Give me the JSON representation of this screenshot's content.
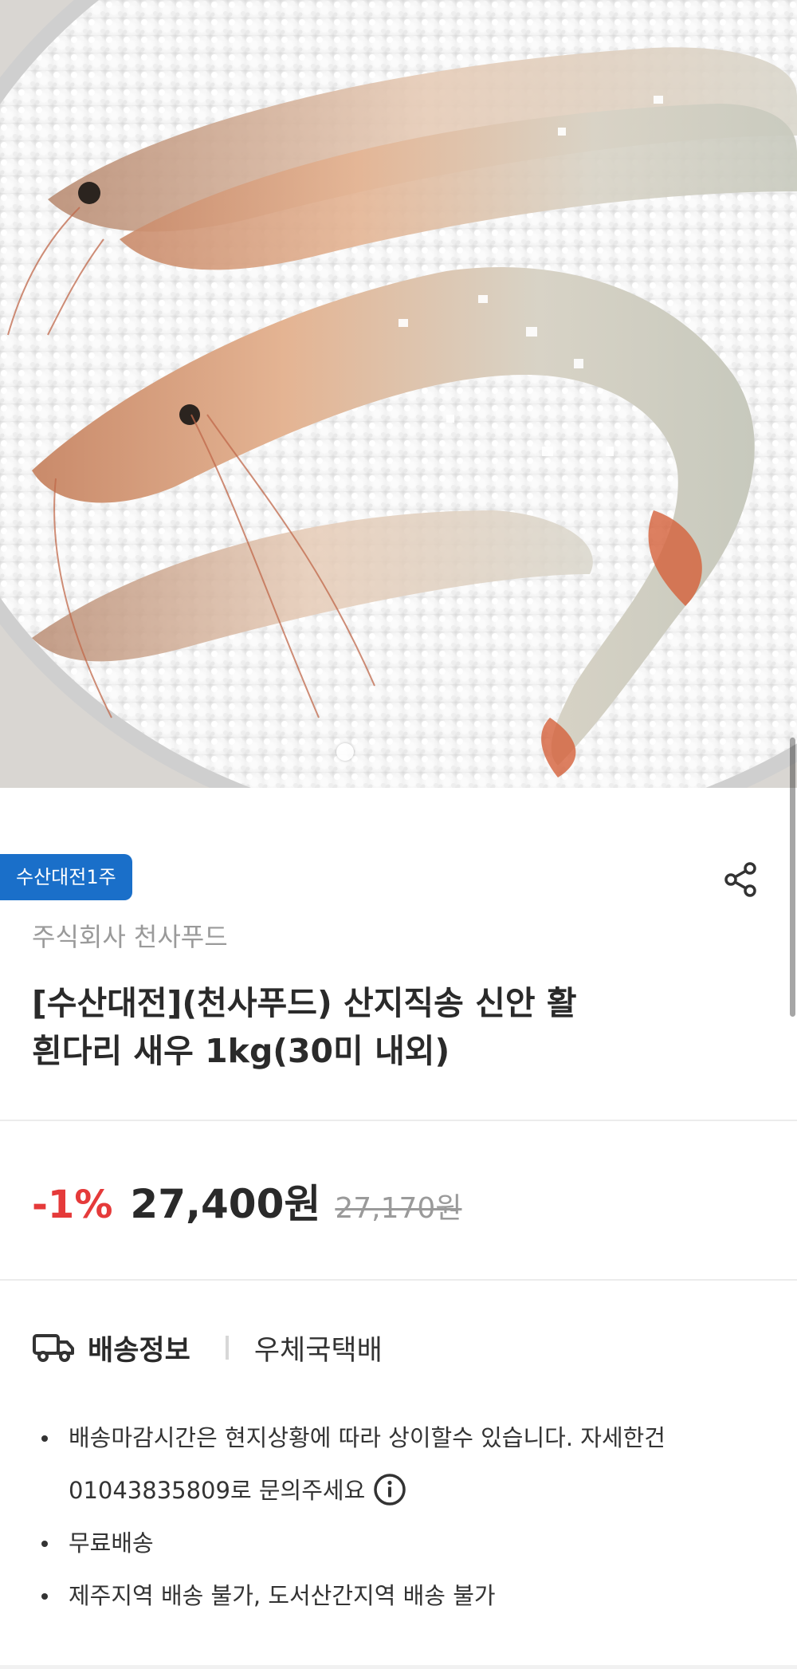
{
  "hero": {
    "alt": "salt-baked shrimp on coarse salt",
    "carousel_active_index": 0
  },
  "product": {
    "badge": "수산대전1주",
    "seller": "주식회사 천사푸드",
    "title_line1": "[수산대전](천사푸드) 산지직송 신안 활",
    "title_line2": "흰다리 새우 1kg(30미 내외)"
  },
  "price": {
    "discount": "-1%",
    "sale": "27,400원",
    "original": "27,170원"
  },
  "delivery": {
    "label": "배송정보",
    "carrier": "우체국택배",
    "notes": [
      "배송마감시간은 현지상황에 따라 상이할수 있습니다. 자세한건",
      "01043835809로 문의주세요",
      "무료배송",
      "제주지역 배송 불가, 도서산간지역 배송 불가"
    ]
  },
  "colors": {
    "badge_bg": "#1a6fc9",
    "discount": "#e53a3a",
    "text": "#2a2a2a",
    "muted": "#9a9a9a"
  },
  "icons": [
    "share-icon",
    "truck-icon",
    "info-icon"
  ]
}
